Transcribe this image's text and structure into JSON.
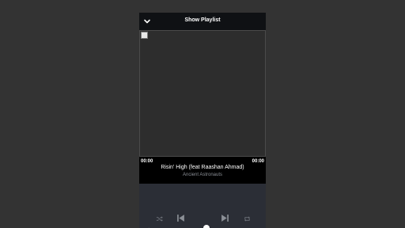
{
  "header": {
    "title": "Show Playlist",
    "collapse_icon": "chevron-down-icon"
  },
  "now_playing": {
    "elapsed": "00:00",
    "duration": "00:00",
    "track_title": "Risin' High (feat Raashan Ahmad)",
    "artist": "Ancient Astronauts",
    "progress": 0
  },
  "controls": {
    "icons": [
      "shuffle-icon",
      "previous-icon",
      "next-icon",
      "repeat-icon",
      "volume-icon"
    ]
  },
  "colors": {
    "page_background": "#333333",
    "header_background": "#0f1114",
    "info_background": "#000000",
    "controls_background": "#2b2e36",
    "icon_muted": "#6e727a",
    "text_primary": "#ffffff",
    "text_secondary": "#8b8f96"
  }
}
